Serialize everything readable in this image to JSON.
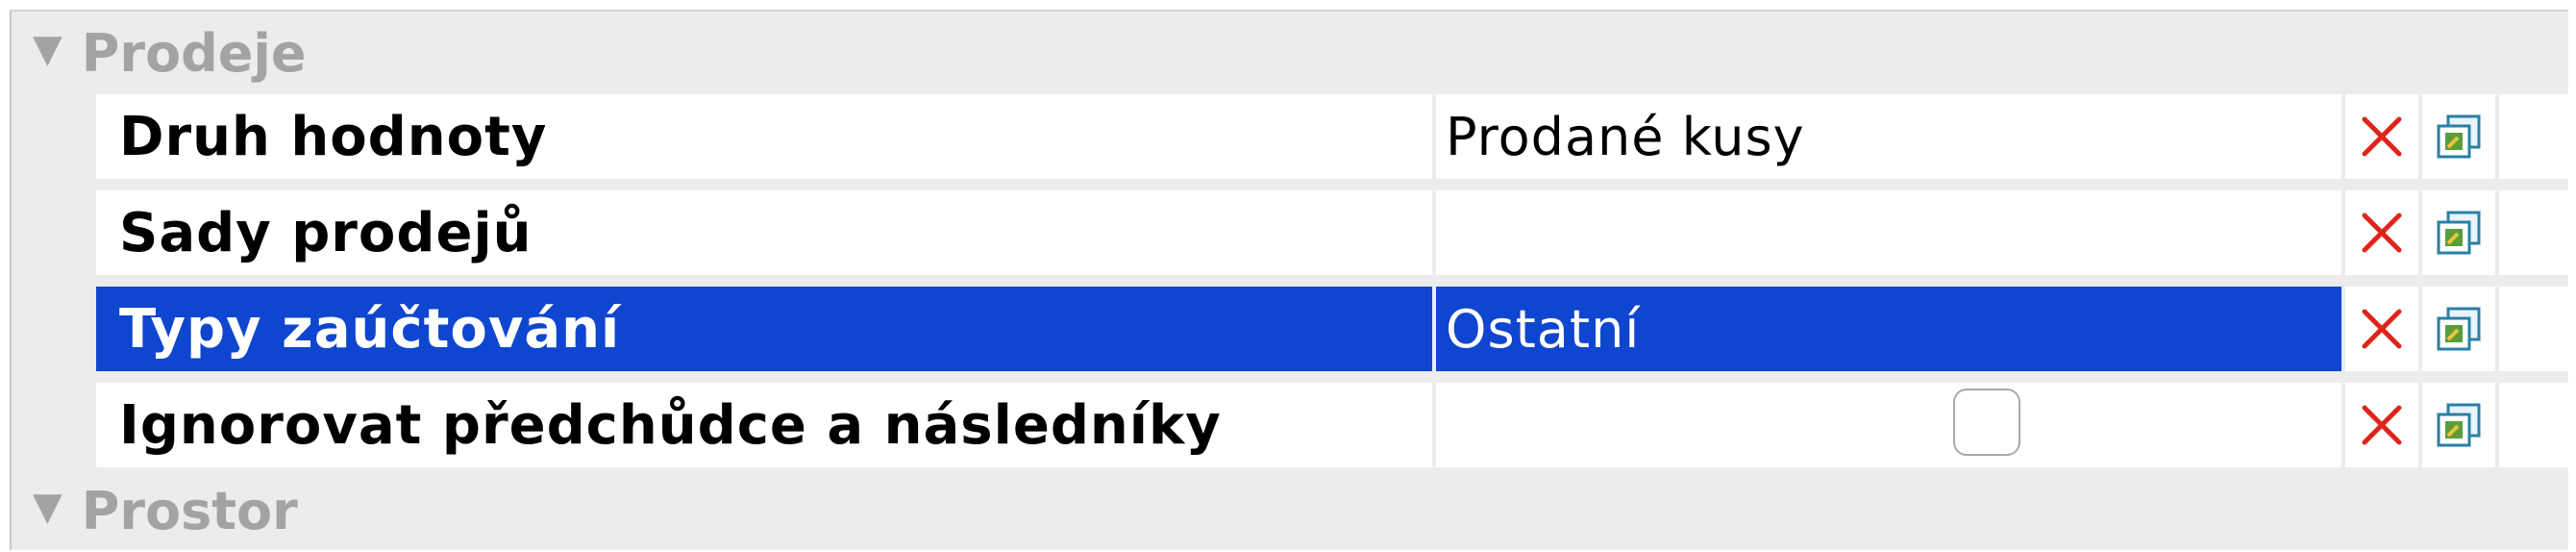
{
  "sections": [
    {
      "title": "Prodeje"
    },
    {
      "title": "Prostor"
    }
  ],
  "rows": [
    {
      "label": "Druh hodnoty",
      "value": "Prodané kusy",
      "selected": false,
      "type": "text"
    },
    {
      "label": "Sady prodejů",
      "value": "",
      "selected": false,
      "type": "text"
    },
    {
      "label": "Typy zaúčtování",
      "value": "Ostatní",
      "selected": true,
      "type": "text"
    },
    {
      "label": "Ignorovat předchůdce a následníky",
      "value": "",
      "selected": false,
      "type": "checkbox",
      "checked": false
    }
  ],
  "icons": {
    "expand": "triangle-down-icon",
    "remove": "red-x-icon",
    "copy": "copy-document-icon"
  },
  "colors": {
    "selection": "#0f46cf",
    "remove_icon": "#e0241b",
    "section_text": "#a3a3a3",
    "panel_bg": "#ececec"
  }
}
